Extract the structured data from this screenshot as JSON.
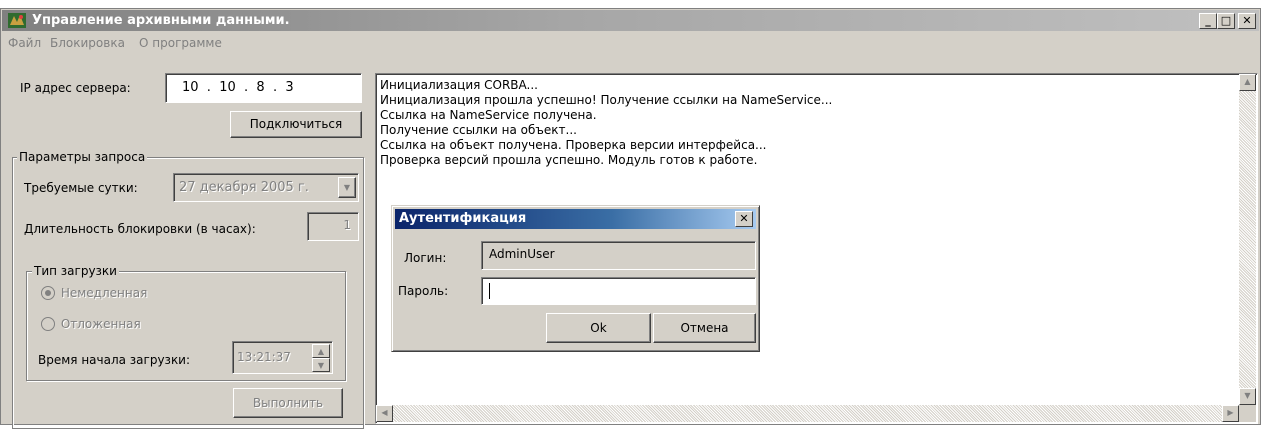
{
  "window": {
    "title": "Управление архивными данными.",
    "buttons": {
      "minimize": "_",
      "maximize": "□",
      "close": "✕"
    }
  },
  "menu": {
    "items": [
      "Файл",
      "Блокировка",
      "О программе"
    ]
  },
  "server": {
    "ip_label": "IP адрес сервера:",
    "ip_value": "10  .  10  .  8  .  3",
    "connect_label": "Подключиться"
  },
  "params": {
    "group_title": "Параметры запроса",
    "day_label": "Требуемые сутки:",
    "day_value": "27 декабря 2005 г.",
    "duration_label": "Длительность блокировки (в часах):",
    "duration_value": "1",
    "load_type": {
      "group_title": "Тип загрузки",
      "option_immediate": "Немедленная",
      "option_deferred": "Отложенная",
      "selected": "Немедленная",
      "start_time_label": "Время начала загрузки:",
      "start_time_value": "13:21:37"
    },
    "execute_label": "Выполнить"
  },
  "log": {
    "lines": [
      "Инициализация CORBA...",
      "Инициализация прошла успешно! Получение ссылки на NameService...",
      "Ссылка на NameService получена.",
      "Получение ссылки на объект...",
      "Ссылка на объект получена. Проверка версии интерфейса...",
      "Проверка версий прошла успешно. Модуль готов к работе."
    ]
  },
  "auth_dialog": {
    "title": "Аутентификация",
    "close_glyph": "✕",
    "login_label": "Логин:",
    "login_value": "AdminUser",
    "password_label": "Пароль:",
    "password_value": "",
    "ok_label": "Ok",
    "cancel_label": "Отмена"
  },
  "colors": {
    "title_inactive": "#808080",
    "dialog_title_active": "#0a246a",
    "face": "#d4d0c8"
  }
}
